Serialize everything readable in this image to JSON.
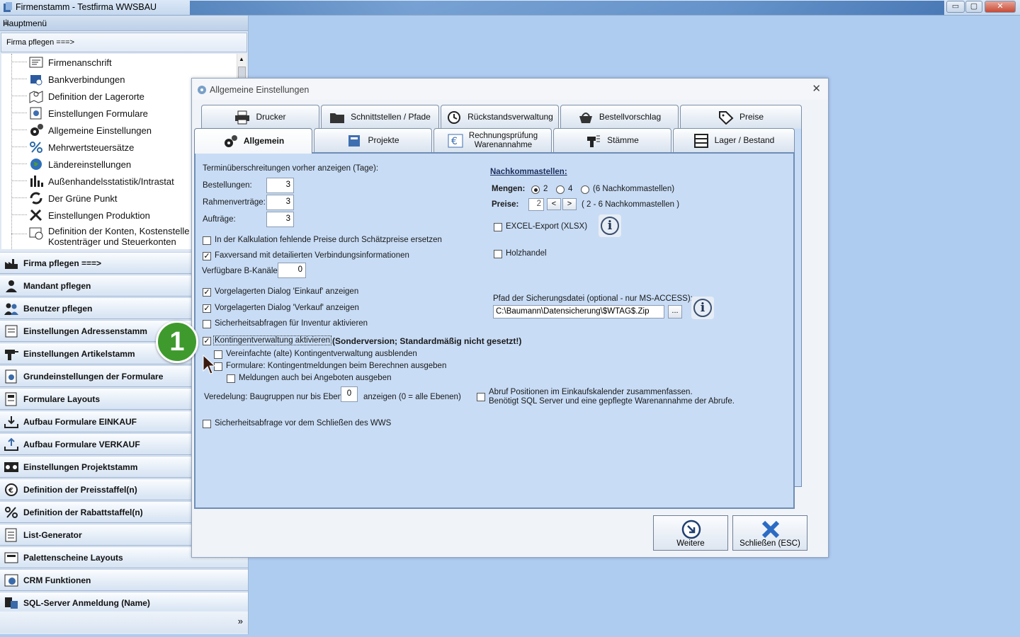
{
  "window": {
    "title": "Firmenstamm - Testfirma WWSBAU",
    "controls": [
      "▭",
      "▢",
      "✕"
    ]
  },
  "sidebar": {
    "header": "Hauptmenü",
    "pin": "ᵖ",
    "sub_header": "Firma pflegen   ===>",
    "tree_items": [
      {
        "label": "Firmenanschrift",
        "icon": "address-card-icon"
      },
      {
        "label": "Bankverbindungen",
        "icon": "bank-icon"
      },
      {
        "label": "Definition der Lagerorte",
        "icon": "map-pin-icon"
      },
      {
        "label": "Einstellungen Formulare",
        "icon": "form-settings-icon"
      },
      {
        "label": "Allgemeine Einstellungen",
        "icon": "gears-icon"
      },
      {
        "label": "Mehrwertsteuersätze",
        "icon": "percent-icon"
      },
      {
        "label": "Ländereinstellungen",
        "icon": "globe-icon"
      },
      {
        "label": "Außenhandelsstatistik/Intrastat",
        "icon": "bar-chart-icon"
      },
      {
        "label": "Der Grüne Punkt",
        "icon": "recycle-icon"
      },
      {
        "label": "Einstellungen Produktion",
        "icon": "tools-icon"
      },
      {
        "label": "Definition der Konten, Kostenstellen, Kostenträger und Steuerkonten",
        "icon": "accounts-icon"
      }
    ],
    "tree_last_line1": "Definition der Konten, Kostenstelle",
    "tree_last_line2": "Kostenträger und Steuerkonten",
    "nav_items": [
      {
        "label": "Firma pflegen   ===>",
        "icon": "factory-icon"
      },
      {
        "label": "Mandant pflegen",
        "icon": "user-icon"
      },
      {
        "label": "Benutzer pflegen",
        "icon": "users-icon"
      },
      {
        "label": "Einstellungen Adressenstamm",
        "icon": "address-book-icon"
      },
      {
        "label": "Einstellungen Artikelstamm",
        "icon": "drill-icon"
      },
      {
        "label": "Grundeinstellungen der Formulare",
        "icon": "form-gear-icon"
      },
      {
        "label": "Formulare Layouts",
        "icon": "layout-icon"
      },
      {
        "label": "Aufbau Formulare EINKAUF",
        "icon": "download-tray-icon"
      },
      {
        "label": "Aufbau Formulare VERKAUF",
        "icon": "upload-tray-icon"
      },
      {
        "label": "Einstellungen Projektstamm",
        "icon": "project-icon"
      },
      {
        "label": "Definition der Preisstaffel(n)",
        "icon": "price-icon"
      },
      {
        "label": "Definition der Rabattstaffel(n)",
        "icon": "discount-icon"
      },
      {
        "label": "List-Generator",
        "icon": "list-icon"
      },
      {
        "label": "Palettenscheine Layouts",
        "icon": "pallet-icon"
      },
      {
        "label": "CRM Funktionen",
        "icon": "crm-icon"
      },
      {
        "label": "SQL-Server Anmeldung (Name)",
        "icon": "database-icon"
      }
    ],
    "more": "»"
  },
  "dialog": {
    "title": "Allgemeine Einstellungen",
    "close": "✕",
    "tabs_row1": [
      {
        "label": "Drucker",
        "icon": "printer-icon"
      },
      {
        "label": "Schnittstellen / Pfade",
        "icon": "folder-icon"
      },
      {
        "label": "Rückstandsverwaltung",
        "icon": "history-icon"
      },
      {
        "label": "Bestellvorschlag",
        "icon": "basket-icon"
      },
      {
        "label": "Preise",
        "icon": "tag-icon"
      }
    ],
    "tabs_row2": [
      {
        "label": "Allgemein",
        "icon": "gears-icon",
        "active": true
      },
      {
        "label": "Projekte",
        "icon": "project-book-icon"
      },
      {
        "label": "Rechnungsprüfung\nWarenannahme",
        "icon": "euro-icon"
      },
      {
        "label": "Stämme",
        "icon": "drill-icon"
      },
      {
        "label": "Lager / Bestand",
        "icon": "shelf-icon"
      }
    ],
    "general": {
      "deadline_heading": "Terminüberschreitungen vorher anzeigen (Tage):",
      "orders_label": "Bestellungen:",
      "orders_value": "3",
      "frame_label": "Rahmenverträge:",
      "frame_value": "3",
      "jobs_label": "Aufträge:",
      "jobs_value": "3",
      "calc_label": "In der Kalkulation fehlende Preise durch Schätzpreise ersetzen",
      "calc_checked": "",
      "fax_label": "Faxversand mit detailierten Verbindungsinformationen",
      "fax_checked": "✓",
      "bchannels_label": "Verfügbare B-Kanäle:",
      "bchannels_value": "0",
      "pre_buy_label": "Vorgelagerten Dialog 'Einkauf' anzeigen",
      "pre_buy_checked": "✓",
      "pre_sell_label": "Vorgelagerten Dialog 'Verkauf' anzeigen",
      "pre_sell_checked": "✓",
      "inventory_label": "Sicherheitsabfragen für Inventur aktivieren",
      "inventory_checked": "",
      "quota_label": "Kontingentverwaltung aktivieren",
      "quota_checked": "✓",
      "quota_note": "(Sonderversion; Standardmäßig nicht gesetzt!)",
      "quota_simple_label": "Vereinfachte (alte) Kontingentverwaltung ausblenden",
      "quota_simple_checked": "",
      "quota_forms_label": "Formulare: Kontingentmeldungen beim Berechnen ausgeben",
      "quota_forms_checked": "",
      "quota_offers_label": "Meldungen auch bei Angeboten ausgeben",
      "quota_offers_checked": "",
      "refine_label": "Veredelung: Baugruppen nur bis Ebene",
      "refine_value": "0",
      "refine_suffix": "anzeigen (0 = alle Ebenen)",
      "close_confirm_label": "Sicherheitsabfrage vor dem Schließen des WWS",
      "close_confirm_checked": ""
    },
    "decimals": {
      "heading": "Nachkommastellen:",
      "qty_label": "Mengen:",
      "qty_options": [
        "2",
        "4",
        "(6 Nachkommastellen)"
      ],
      "qty_selected": "2",
      "price_label": "Preise:",
      "price_value": "2",
      "prev": "<",
      "next": ">",
      "price_hint": "( 2 - 6 Nachkommastellen )"
    },
    "excel_label": "EXCEL-Export (XLSX)",
    "excel_checked": "",
    "wood_label": "Holzhandel",
    "wood_checked": "",
    "backup_label": "Pfad der Sicherungsdatei (optional - nur MS-ACCESS):",
    "backup_value": "C:\\Baumann\\Datensicherung\\$WTAG$.Zip",
    "browse": "...",
    "info_glyph": "i",
    "calls_label_line1": "Abruf Positionen im Einkaufskalender zusammenfassen.",
    "calls_label_line2": "Benötigt SQL Server und eine gepflegte Warenannahme der Abrufe.",
    "calls_checked": "",
    "next_button": "Weitere",
    "close_button": "Schließen (ESC)"
  },
  "annotation": {
    "badge": "1"
  },
  "colors": {
    "accent_green": "#3f9a2d",
    "panel_blue": "#c8dcf5",
    "desktop_blue": "#aecbf0"
  }
}
